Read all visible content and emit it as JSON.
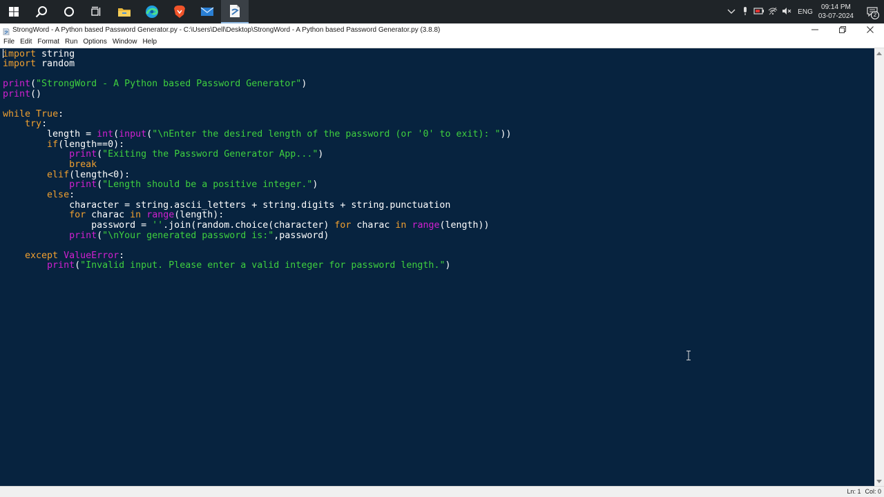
{
  "taskbar": {
    "icons": [
      "windows-start-icon",
      "search-icon",
      "cortana-icon",
      "task-view-icon",
      "file-explorer-icon",
      "edge-browser-icon",
      "brave-browser-icon",
      "mail-icon",
      "idle-python-icon"
    ],
    "tray": {
      "language": "ENG",
      "time": "09:14 PM",
      "date": "03-07-2024",
      "notification_count": "2"
    }
  },
  "window": {
    "title": "StrongWord - A Python based Password Generator.py - C:\\Users\\Dell\\Desktop\\StrongWord - A Python based Password Generator.py (3.8.8)"
  },
  "menu": {
    "items": [
      "File",
      "Edit",
      "Format",
      "Run",
      "Options",
      "Window",
      "Help"
    ]
  },
  "colors": {
    "editor_bg": "#07233f",
    "keyword": "#f0a030",
    "builtin": "#d020d0",
    "string": "#3fd03f",
    "default": "#ffffff"
  },
  "code": {
    "lines": [
      [
        {
          "t": "import",
          "c": "kw"
        },
        {
          "t": " string",
          "c": "n"
        }
      ],
      [
        {
          "t": "import",
          "c": "kw"
        },
        {
          "t": " random",
          "c": "n"
        }
      ],
      [],
      [
        {
          "t": "print",
          "c": "bi"
        },
        {
          "t": "(",
          "c": "n"
        },
        {
          "t": "\"StrongWord - A Python based Password Generator\"",
          "c": "st"
        },
        {
          "t": ")",
          "c": "n"
        }
      ],
      [
        {
          "t": "print",
          "c": "bi"
        },
        {
          "t": "()",
          "c": "n"
        }
      ],
      [],
      [
        {
          "t": "while",
          "c": "kw"
        },
        {
          "t": " ",
          "c": "n"
        },
        {
          "t": "True",
          "c": "kw"
        },
        {
          "t": ":",
          "c": "n"
        }
      ],
      [
        {
          "t": "    ",
          "c": "n"
        },
        {
          "t": "try",
          "c": "kw"
        },
        {
          "t": ":",
          "c": "n"
        }
      ],
      [
        {
          "t": "        length = ",
          "c": "n"
        },
        {
          "t": "int",
          "c": "bi"
        },
        {
          "t": "(",
          "c": "n"
        },
        {
          "t": "input",
          "c": "bi"
        },
        {
          "t": "(",
          "c": "n"
        },
        {
          "t": "\"\\nEnter the desired length of the password (or '0' to exit): \"",
          "c": "st"
        },
        {
          "t": "))",
          "c": "n"
        }
      ],
      [
        {
          "t": "        ",
          "c": "n"
        },
        {
          "t": "if",
          "c": "kw"
        },
        {
          "t": "(length==0):",
          "c": "n"
        }
      ],
      [
        {
          "t": "            ",
          "c": "n"
        },
        {
          "t": "print",
          "c": "bi"
        },
        {
          "t": "(",
          "c": "n"
        },
        {
          "t": "\"Exiting the Password Generator App...\"",
          "c": "st"
        },
        {
          "t": ")",
          "c": "n"
        }
      ],
      [
        {
          "t": "            ",
          "c": "n"
        },
        {
          "t": "break",
          "c": "kw"
        }
      ],
      [
        {
          "t": "        ",
          "c": "n"
        },
        {
          "t": "elif",
          "c": "kw"
        },
        {
          "t": "(length<0):",
          "c": "n"
        }
      ],
      [
        {
          "t": "            ",
          "c": "n"
        },
        {
          "t": "print",
          "c": "bi"
        },
        {
          "t": "(",
          "c": "n"
        },
        {
          "t": "\"Length should be a positive integer.\"",
          "c": "st"
        },
        {
          "t": ")",
          "c": "n"
        }
      ],
      [
        {
          "t": "        ",
          "c": "n"
        },
        {
          "t": "else",
          "c": "kw"
        },
        {
          "t": ":",
          "c": "n"
        }
      ],
      [
        {
          "t": "            character = string.ascii_letters + string.digits + string.punctuation",
          "c": "n"
        }
      ],
      [
        {
          "t": "            ",
          "c": "n"
        },
        {
          "t": "for",
          "c": "kw"
        },
        {
          "t": " charac ",
          "c": "n"
        },
        {
          "t": "in",
          "c": "kw"
        },
        {
          "t": " ",
          "c": "n"
        },
        {
          "t": "range",
          "c": "bi"
        },
        {
          "t": "(length):",
          "c": "n"
        }
      ],
      [
        {
          "t": "                password = ",
          "c": "n"
        },
        {
          "t": "''",
          "c": "st"
        },
        {
          "t": ".join(random.choice(character) ",
          "c": "n"
        },
        {
          "t": "for",
          "c": "kw"
        },
        {
          "t": " charac ",
          "c": "n"
        },
        {
          "t": "in",
          "c": "kw"
        },
        {
          "t": " ",
          "c": "n"
        },
        {
          "t": "range",
          "c": "bi"
        },
        {
          "t": "(length))",
          "c": "n"
        }
      ],
      [
        {
          "t": "            ",
          "c": "n"
        },
        {
          "t": "print",
          "c": "bi"
        },
        {
          "t": "(",
          "c": "n"
        },
        {
          "t": "\"\\nYour generated password is:\"",
          "c": "st"
        },
        {
          "t": ",password)",
          "c": "n"
        }
      ],
      [],
      [
        {
          "t": "    ",
          "c": "n"
        },
        {
          "t": "except",
          "c": "kw"
        },
        {
          "t": " ",
          "c": "n"
        },
        {
          "t": "ValueError",
          "c": "bi"
        },
        {
          "t": ":",
          "c": "n"
        }
      ],
      [
        {
          "t": "        ",
          "c": "n"
        },
        {
          "t": "print",
          "c": "bi"
        },
        {
          "t": "(",
          "c": "n"
        },
        {
          "t": "\"Invalid input. Please enter a valid integer for password length.\"",
          "c": "st"
        },
        {
          "t": ")",
          "c": "n"
        }
      ]
    ]
  },
  "status": {
    "line": "Ln: 1",
    "col": "Col: 0"
  }
}
